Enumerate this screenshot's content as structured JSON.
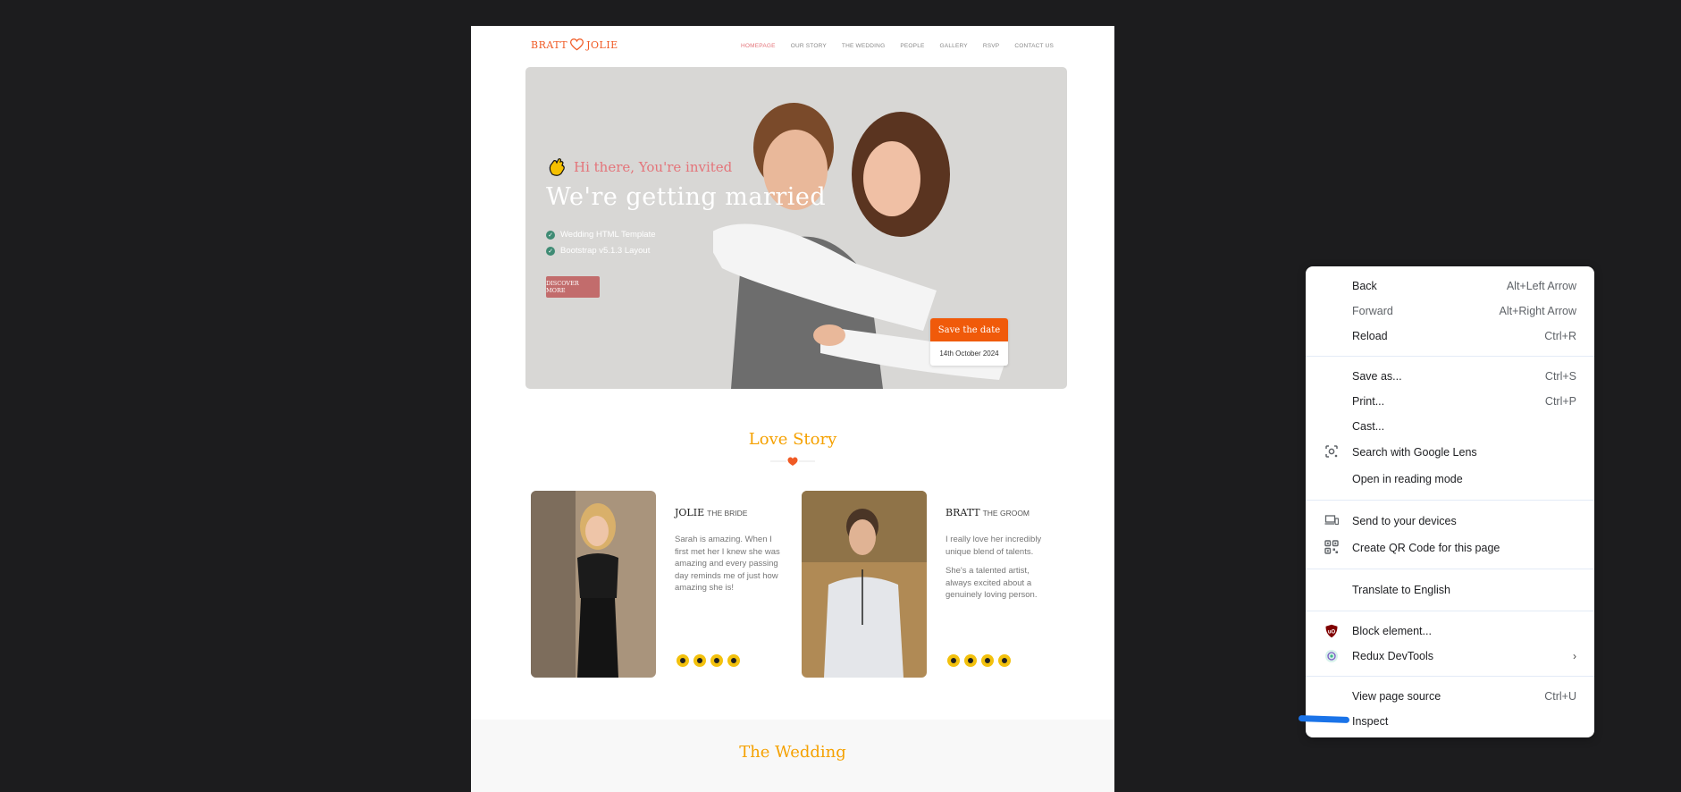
{
  "site": {
    "logo_left": "BRATT",
    "logo_right": "JOLIE",
    "nav": [
      {
        "label": "HOMEPAGE",
        "active": true
      },
      {
        "label": "OUR STORY",
        "active": false
      },
      {
        "label": "THE WEDDING",
        "active": false
      },
      {
        "label": "PEOPLE",
        "active": false
      },
      {
        "label": "GALLERY",
        "active": false
      },
      {
        "label": "RSVP",
        "active": false
      },
      {
        "label": "CONTACT US",
        "active": false
      }
    ],
    "hero": {
      "greeting": "Hi there, You're invited",
      "title": "We're getting married",
      "features": [
        "Wedding HTML Template",
        "Bootstrap v5.1.3 Layout"
      ],
      "button": "DISCOVER MORE",
      "save_title": "Save the date",
      "save_date": "14th October 2024"
    },
    "love_story": {
      "title": "Love Story",
      "bride": {
        "name": "JOLIE",
        "role": "THE BRIDE",
        "bio": [
          "Sarah is amazing. When I first met her I knew she was amazing and every passing day reminds me of just how amazing she is!"
        ]
      },
      "groom": {
        "name": "BRATT",
        "role": "THE GROOM",
        "bio": [
          "I really love her incredibly unique blend of talents.",
          "She's a talented artist, always excited about a genuinely loving person."
        ]
      }
    },
    "wedding_title": "The Wedding"
  },
  "context_menu": {
    "groups": [
      [
        {
          "label": "Back",
          "shortcut": "Alt+Left Arrow",
          "icon": null,
          "disabled": false
        },
        {
          "label": "Forward",
          "shortcut": "Alt+Right Arrow",
          "icon": null,
          "disabled": true
        },
        {
          "label": "Reload",
          "shortcut": "Ctrl+R",
          "icon": null,
          "disabled": false
        }
      ],
      [
        {
          "label": "Save as...",
          "shortcut": "Ctrl+S",
          "icon": null
        },
        {
          "label": "Print...",
          "shortcut": "Ctrl+P",
          "icon": null
        },
        {
          "label": "Cast...",
          "shortcut": "",
          "icon": null
        },
        {
          "label": "Search with Google Lens",
          "shortcut": "",
          "icon": "google-lens-icon"
        },
        {
          "label": "Open in reading mode",
          "shortcut": "",
          "icon": null
        }
      ],
      [
        {
          "label": "Send to your devices",
          "shortcut": "",
          "icon": "devices-icon"
        },
        {
          "label": "Create QR Code for this page",
          "shortcut": "",
          "icon": "qr-code-icon"
        }
      ],
      [
        {
          "label": "Translate to English",
          "shortcut": "",
          "icon": null
        }
      ],
      [
        {
          "label": "Block element...",
          "shortcut": "",
          "icon": "ublock-icon"
        },
        {
          "label": "Redux DevTools",
          "shortcut": "",
          "icon": "redux-icon",
          "submenu": true
        }
      ],
      [
        {
          "label": "View page source",
          "shortcut": "Ctrl+U",
          "icon": null
        },
        {
          "label": "Inspect",
          "shortcut": "",
          "icon": null
        }
      ]
    ]
  },
  "colors": {
    "accent_orange": "#f05a24",
    "accent_pink": "#e4747a",
    "accent_gold": "#f5a100",
    "check_green": "#3f8b74",
    "inspect_highlight": "#1a73e8"
  }
}
